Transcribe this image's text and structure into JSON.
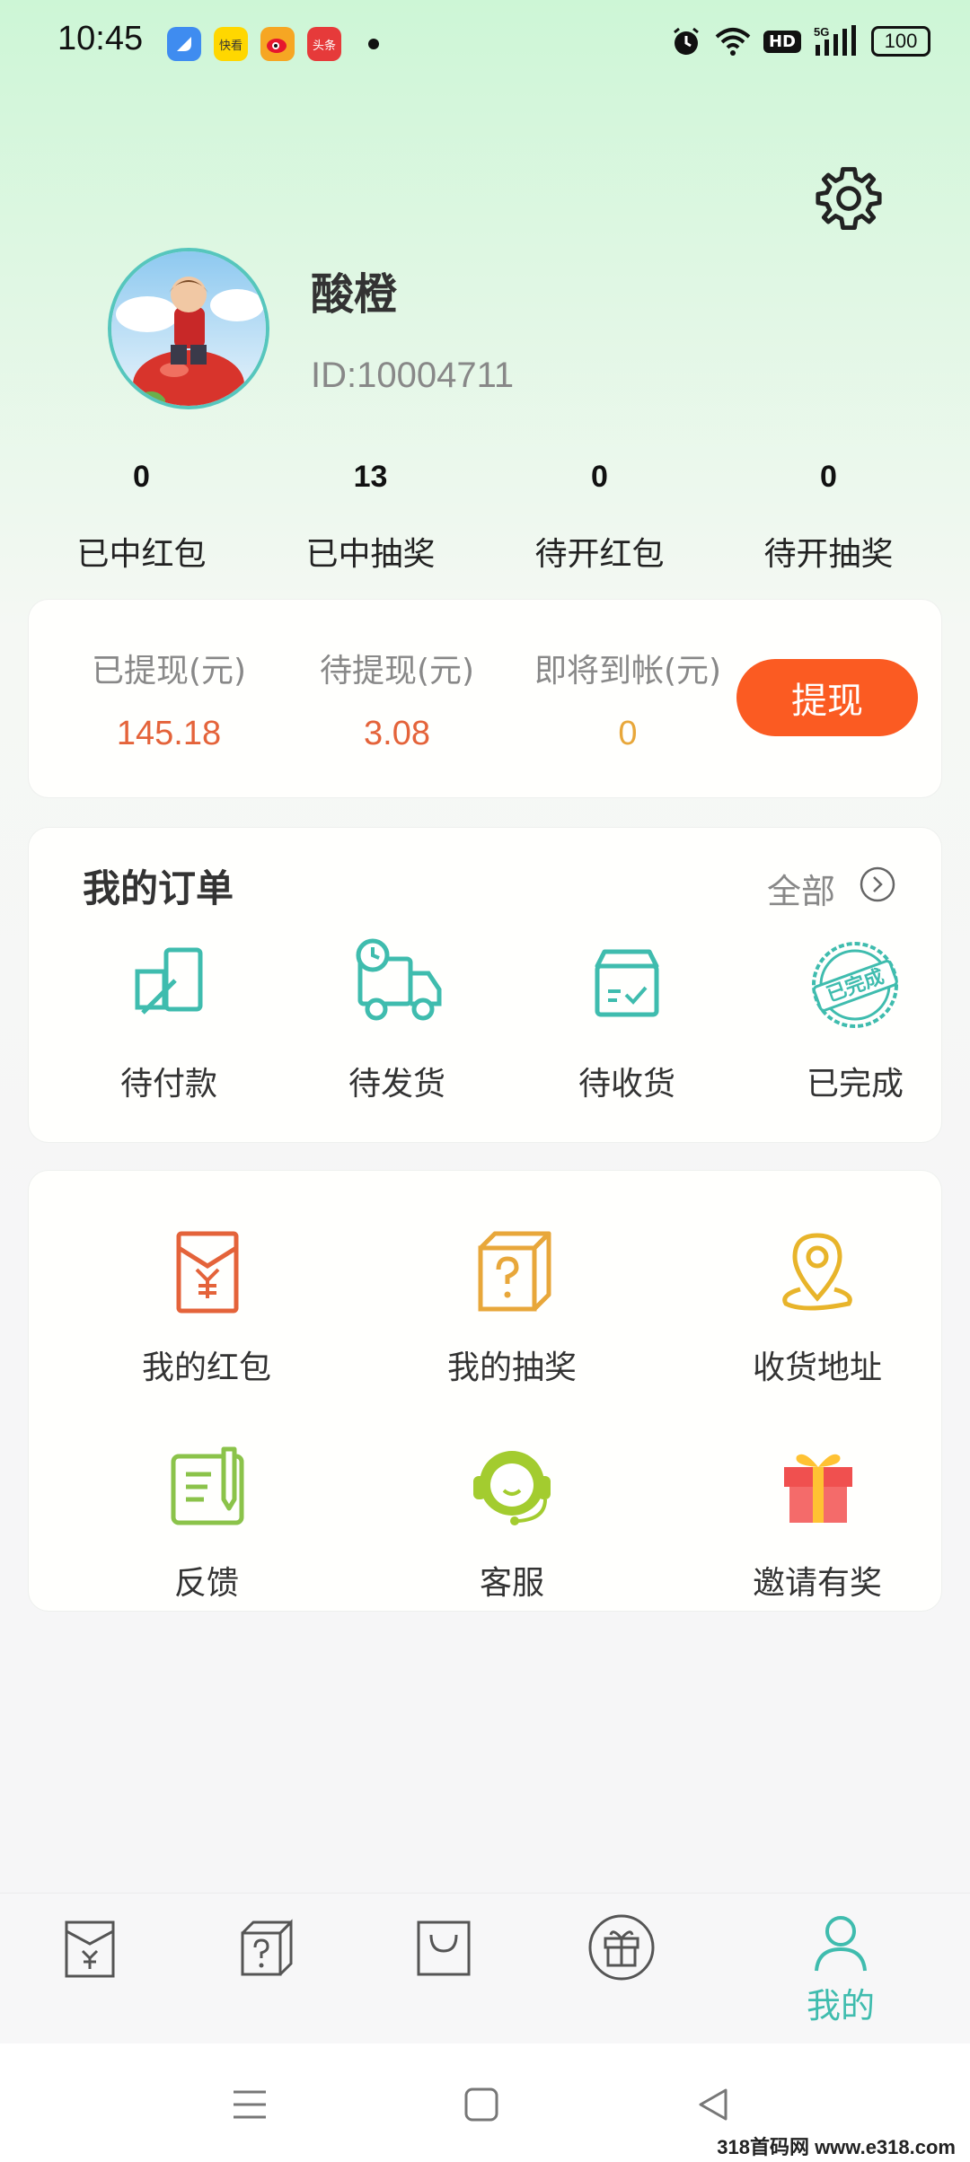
{
  "status": {
    "time": "10:45",
    "apps": [
      {
        "icon": "blue-app-icon",
        "label": "",
        "color": "#3f8cf0"
      },
      {
        "icon": "kuaikan-app-icon",
        "label": "快看",
        "color": "#ffd700"
      },
      {
        "icon": "weibo-app-icon",
        "label": "",
        "color": "#f6a623"
      },
      {
        "icon": "toutiao-app-icon",
        "label": "头条",
        "color": "#e63a3a"
      }
    ],
    "hd": "HD",
    "network": "5G",
    "battery": "100"
  },
  "profile": {
    "nickname": "酸橙",
    "id": "ID:10004711"
  },
  "stats": [
    {
      "value": "0",
      "label": "已中红包"
    },
    {
      "value": "13",
      "label": "已中抽奖"
    },
    {
      "value": "0",
      "label": "待开红包"
    },
    {
      "value": "0",
      "label": "待开抽奖"
    }
  ],
  "withdraw": {
    "items": [
      {
        "label": "已提现(元)",
        "value": "145.18"
      },
      {
        "label": "待提现(元)",
        "value": "3.08"
      },
      {
        "label": "即将到帐(元)",
        "value": "0"
      }
    ],
    "button": "提现"
  },
  "orders": {
    "title": "我的订单",
    "all": "全部",
    "items": [
      {
        "label": "待付款",
        "icon": "pending-payment-icon"
      },
      {
        "label": "待发货",
        "icon": "truck-icon"
      },
      {
        "label": "待收货",
        "icon": "package-icon"
      },
      {
        "label": "已完成",
        "icon": "completed-stamp-icon",
        "stamp": "已完成"
      }
    ]
  },
  "services": [
    {
      "label": "我的红包",
      "icon": "red-envelope-icon"
    },
    {
      "label": "我的抽奖",
      "icon": "mystery-box-icon"
    },
    {
      "label": "收货地址",
      "icon": "location-icon"
    },
    {
      "label": "反馈",
      "icon": "feedback-icon"
    },
    {
      "label": "客服",
      "icon": "customer-service-icon"
    },
    {
      "label": "邀请有奖",
      "icon": "gift-icon"
    }
  ],
  "tabbar": {
    "active_label": "我的",
    "active_color": "#3fbcae"
  },
  "colors": {
    "accent": "#fb5b22",
    "teal": "#3fbcae",
    "orange_value": "#e4633a",
    "yellow_value": "#e8a73a"
  },
  "watermark": "318首码网 www.e318.com"
}
